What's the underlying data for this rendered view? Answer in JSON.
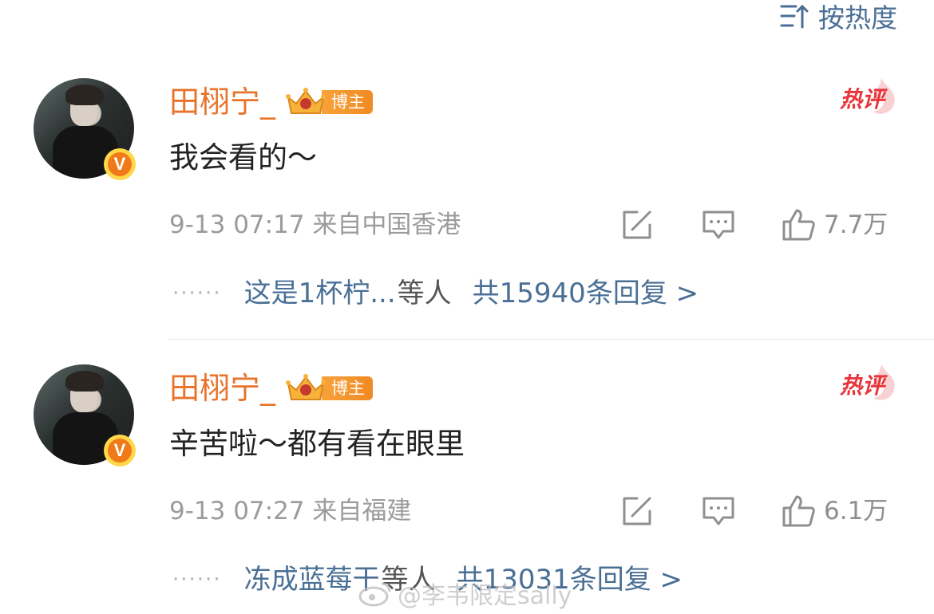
{
  "sort": {
    "label": "按热度"
  },
  "comments": [
    {
      "author": "田栩宁_",
      "badge": "博主",
      "hot_label": "热评",
      "text": "我会看的～",
      "timestamp": "9-13 07:17",
      "location": "来自中国香港",
      "likes": "7.7万",
      "reply_users": "这是1杯柠...",
      "reply_suffix": "等人",
      "reply_total": "共15940条回复 >"
    },
    {
      "author": "田栩宁_",
      "badge": "博主",
      "hot_label": "热评",
      "text": "辛苦啦～都有看在眼里",
      "timestamp": "9-13 07:27",
      "location": "来自福建",
      "likes": "6.1万",
      "reply_users": "冻成蓝莓干",
      "reply_suffix": "等人",
      "reply_total": "共13031条回复 >"
    }
  ],
  "watermark": {
    "text": "@李韦限定sally"
  },
  "colors": {
    "accent_name": "#e8732a",
    "link": "#4a6f95",
    "hot": "#e8343a",
    "meta": "#9b9b9b"
  },
  "icons": [
    "sort-icon",
    "verified-icon",
    "crown-icon",
    "hot-flame-icon",
    "repost-icon",
    "comment-icon",
    "like-icon",
    "weibo-logo-icon"
  ]
}
